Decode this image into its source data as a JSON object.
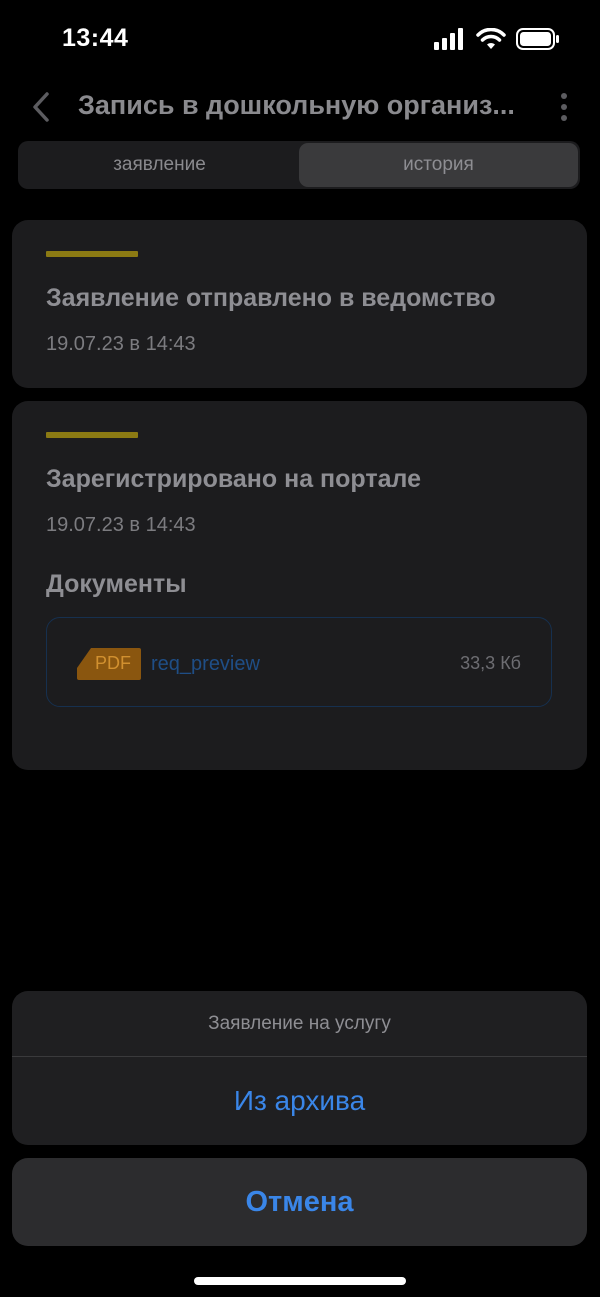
{
  "status_bar": {
    "time": "13:44",
    "icons": [
      "cellular-signal-icon",
      "wifi-icon",
      "battery-icon"
    ]
  },
  "header": {
    "title": "Запись в дошкольную организ...",
    "back_icon": "chevron-left-icon",
    "more_icon": "more-vertical-icon"
  },
  "tabs": [
    {
      "label": "заявление",
      "active": false
    },
    {
      "label": "история",
      "active": true
    }
  ],
  "history": [
    {
      "title": "Заявление отправлено в ведомство",
      "date": "19.07.23 в 14:43"
    },
    {
      "title": "Зарегистрировано на портале",
      "date": "19.07.23 в 14:43",
      "documents_label": "Документы",
      "documents": [
        {
          "type": "PDF",
          "name": "req_preview",
          "size": "33,3 Кб"
        }
      ]
    }
  ],
  "action_sheet": {
    "title": "Заявление на услугу",
    "actions": [
      "Из архива"
    ],
    "cancel_label": "Отмена"
  },
  "colors": {
    "accent": "#3a86e8",
    "status_bar_gold": "#8b7a13",
    "pdf_orange": "#d1902f",
    "background": "#000000",
    "card": "#1c1c1e"
  }
}
